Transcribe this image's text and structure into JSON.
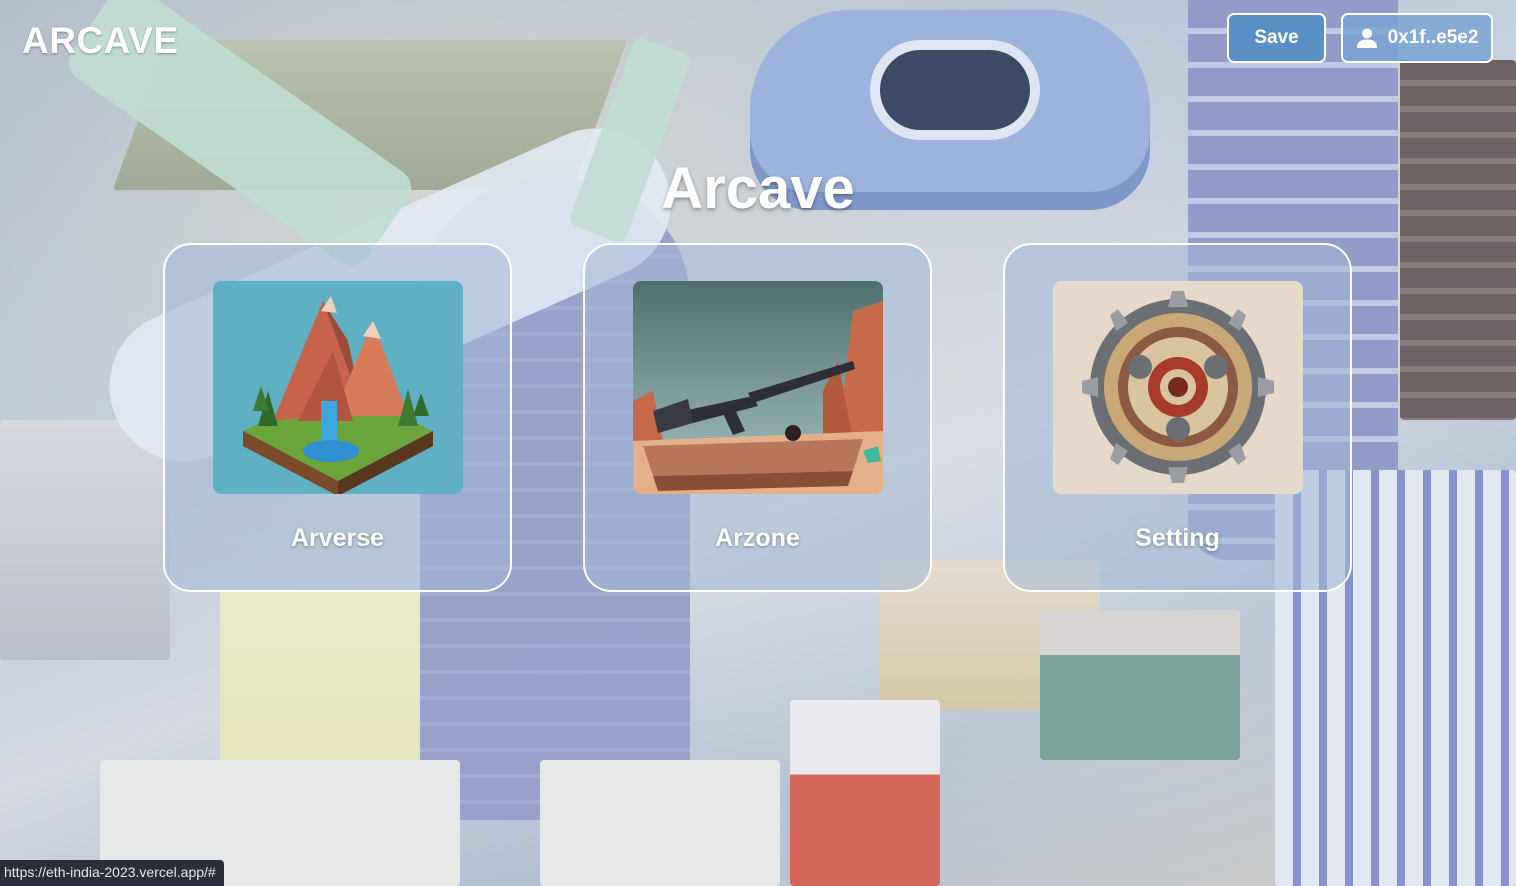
{
  "header": {
    "brand": "ARCAVE",
    "save_label": "Save",
    "account_label": "0x1f..e5e2",
    "account_icon": "user-icon"
  },
  "main": {
    "title": "Arcave",
    "cards": [
      {
        "label": "Arverse",
        "image": "low-poly-mountain-island-image"
      },
      {
        "label": "Arzone",
        "image": "low-poly-rifle-image"
      },
      {
        "label": "Setting",
        "image": "gear-image"
      }
    ]
  },
  "status_bar": {
    "url": "https://eth-india-2023.vercel.app/#"
  },
  "colors": {
    "save_button": "#5a8fc5",
    "account_button": "#7aa4d4",
    "text": "#ffffff",
    "card_fill": "rgba(160,185,215,0.55)"
  }
}
